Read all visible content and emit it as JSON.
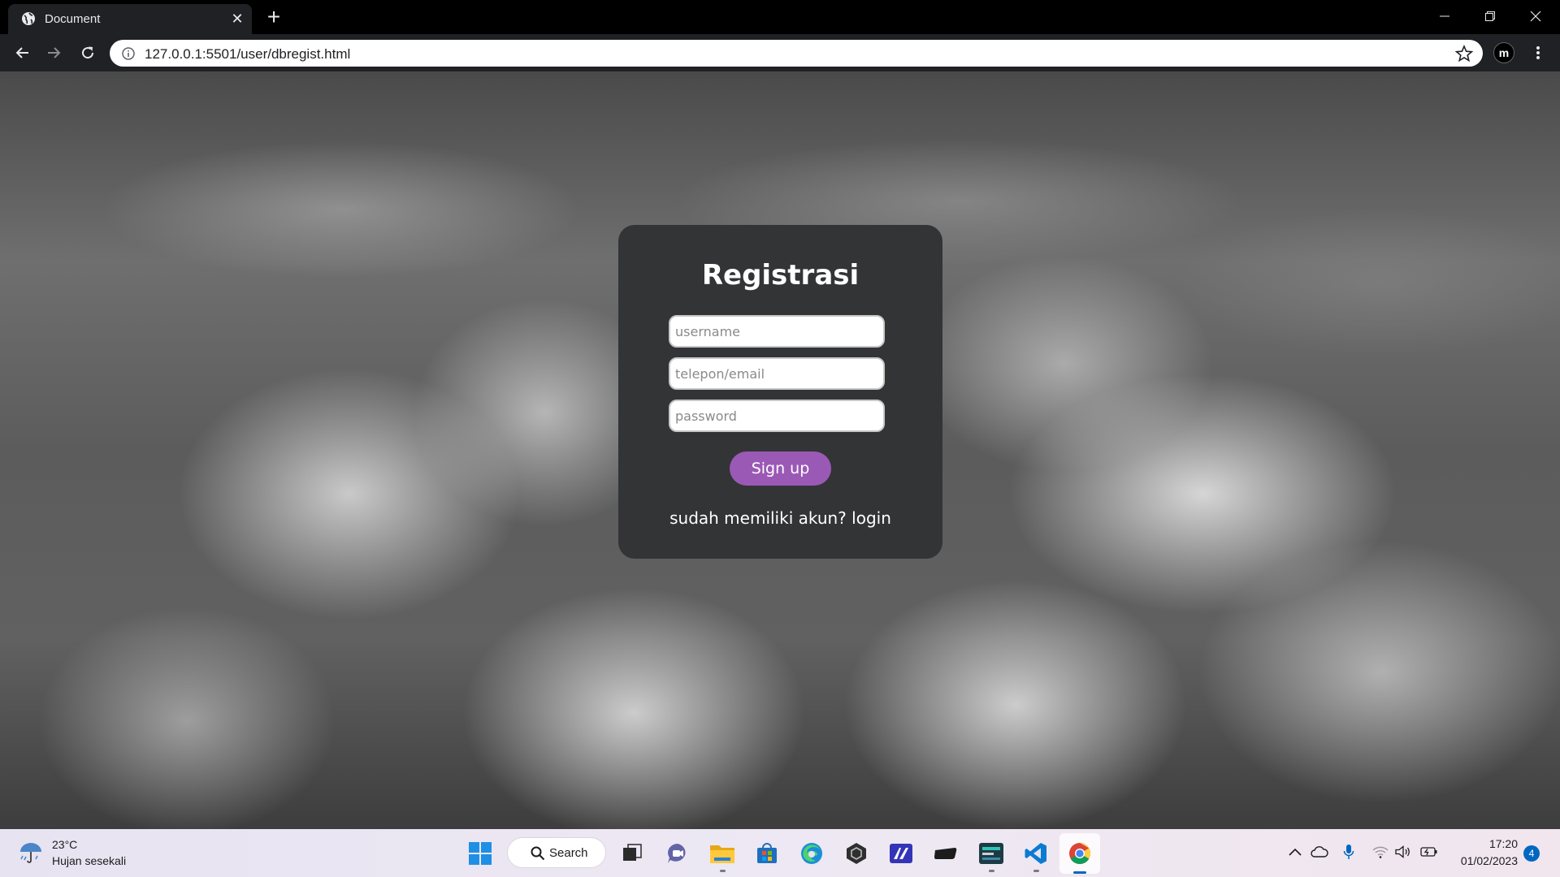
{
  "browser": {
    "tab_title": "Document",
    "url": "127.0.0.1:5501/user/dbregist.html",
    "profile_initial": "m"
  },
  "form": {
    "title": "Registrasi",
    "username_placeholder": "username",
    "contact_placeholder": "telepon/email",
    "password_placeholder": "password",
    "signup_label": "Sign up",
    "login_prompt": "sudah memiliki akun?",
    "login_link": "login",
    "colors": {
      "card": "#333436",
      "button": "#9b59b6"
    }
  },
  "taskbar": {
    "weather_temp": "23°C",
    "weather_desc": "Hujan sesekali",
    "search_label": "Search",
    "apps": [
      "start-icon",
      "search-icon",
      "task-view-icon",
      "teams-chat-icon",
      "file-explorer-icon",
      "store-icon",
      "edge-icon",
      "unity-icon",
      "app-icon",
      "terminal-icon",
      "mysql-workbench-icon",
      "vscode-icon",
      "chrome-icon"
    ],
    "clock_time": "17:20",
    "clock_date": "01/02/2023",
    "notification_count": "4"
  }
}
